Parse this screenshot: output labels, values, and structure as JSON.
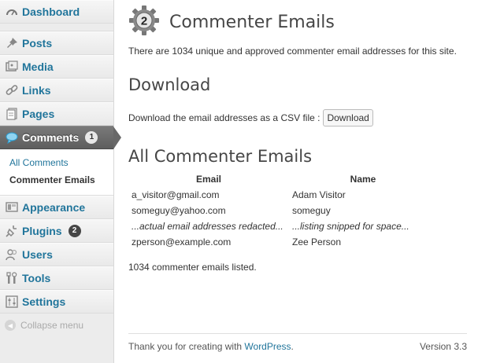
{
  "sidebar": {
    "items": [
      {
        "label": "Dashboard",
        "icon": "dashboard-icon"
      },
      {
        "label": "Posts",
        "icon": "pin-icon"
      },
      {
        "label": "Media",
        "icon": "media-icon"
      },
      {
        "label": "Links",
        "icon": "link-icon"
      },
      {
        "label": "Pages",
        "icon": "pages-icon"
      },
      {
        "label": "Comments",
        "icon": "comment-icon",
        "badge": "1",
        "active": true
      },
      {
        "label": "Appearance",
        "icon": "appearance-icon"
      },
      {
        "label": "Plugins",
        "icon": "plug-icon",
        "badge": "2"
      },
      {
        "label": "Users",
        "icon": "users-icon"
      },
      {
        "label": "Tools",
        "icon": "tools-icon"
      },
      {
        "label": "Settings",
        "icon": "settings-icon"
      }
    ],
    "submenu": [
      "All Comments",
      "Commenter Emails"
    ],
    "collapse_label": "Collapse menu"
  },
  "main": {
    "title": "Commenter Emails",
    "title_icon_number": "2",
    "summary": "There are 1034 unique and approved commenter email addresses for this site.",
    "download_heading": "Download",
    "download_text": "Download the email addresses as a CSV file :",
    "download_button": "Download",
    "emails_heading": "All Commenter Emails",
    "table": {
      "headers": [
        "Email",
        "Name"
      ],
      "rows": [
        [
          "a_visitor@gmail.com",
          "Adam Visitor"
        ],
        [
          "someguy@yahoo.com",
          "someguy"
        ],
        [
          "...actual email addresses redacted...",
          "...listing snipped for space..."
        ],
        [
          "zperson@example.com",
          "Zee Person"
        ]
      ]
    },
    "count_text": "1034 commenter emails listed."
  },
  "footer": {
    "thanks_prefix": "Thank you for creating with ",
    "thanks_link": "WordPress",
    "thanks_suffix": ".",
    "version": "Version 3.3"
  },
  "colors": {
    "link": "#21759b",
    "active_menu": "#6d6d6d",
    "sidebar_bg": "#ececec"
  }
}
